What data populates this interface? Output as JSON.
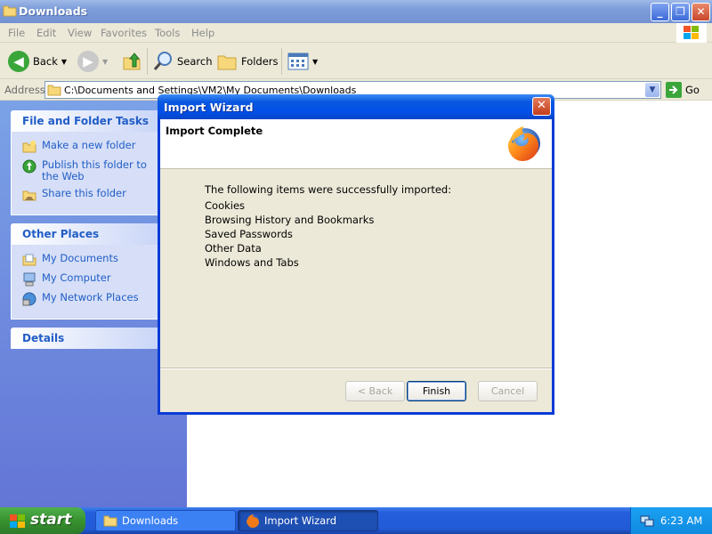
{
  "explorer": {
    "title": "Downloads",
    "menu": [
      "File",
      "Edit",
      "View",
      "Favorites",
      "Tools",
      "Help"
    ],
    "toolbar": {
      "back_label": "Back",
      "search_label": "Search",
      "folders_label": "Folders"
    },
    "address": {
      "label": "Address",
      "value": "C:\\Documents and Settings\\VM2\\My Documents\\Downloads",
      "go_label": "Go"
    },
    "sidebar": {
      "tasks": {
        "title": "File and Folder Tasks",
        "items": [
          "Make a new folder",
          "Publish this folder to the Web",
          "Share this folder"
        ]
      },
      "places": {
        "title": "Other Places",
        "items": [
          "My Documents",
          "My Computer",
          "My Network Places"
        ]
      },
      "details": {
        "title": "Details"
      }
    }
  },
  "dialog": {
    "title": "Import Wizard",
    "header": "Import Complete",
    "intro": "The following items were successfully imported:",
    "items": [
      "Cookies",
      "Browsing History and Bookmarks",
      "Saved Passwords",
      "Other Data",
      "Windows and Tabs"
    ],
    "buttons": {
      "back": "< Back",
      "finish": "Finish",
      "cancel": "Cancel"
    }
  },
  "taskbar": {
    "start_label": "start",
    "tasks": [
      "Downloads",
      "Import Wizard"
    ],
    "clock": "6:23 AM"
  },
  "colors": {
    "xp_blue": "#0050e6",
    "sidebar_link": "#215dc6",
    "start_green": "#37922f"
  }
}
